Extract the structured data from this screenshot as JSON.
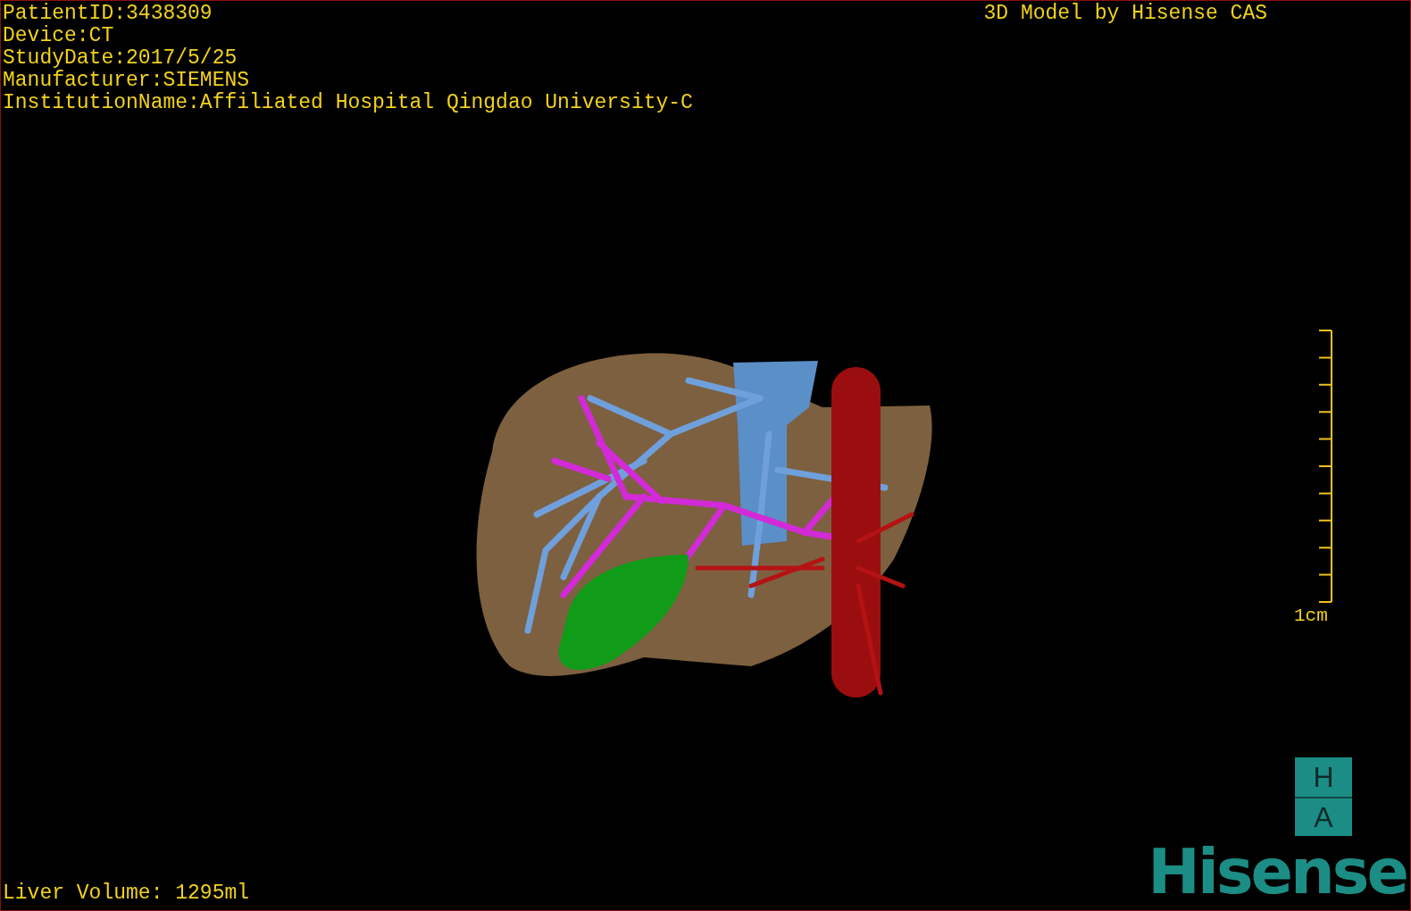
{
  "info_lines": [
    "PatientID:3438309",
    "Device:CT",
    "StudyDate:2017/5/25",
    "Manufacturer:SIEMENS",
    "InstitutionName:Affiliated Hospital Qingdao University-C"
  ],
  "title": "3D Model by Hisense CAS",
  "scale_bar": {
    "label": "1cm"
  },
  "orientation_marker": {
    "top": "H",
    "bottom": "A"
  },
  "liver_volume": "Liver Volume: 1295ml",
  "logo": "Hisense"
}
